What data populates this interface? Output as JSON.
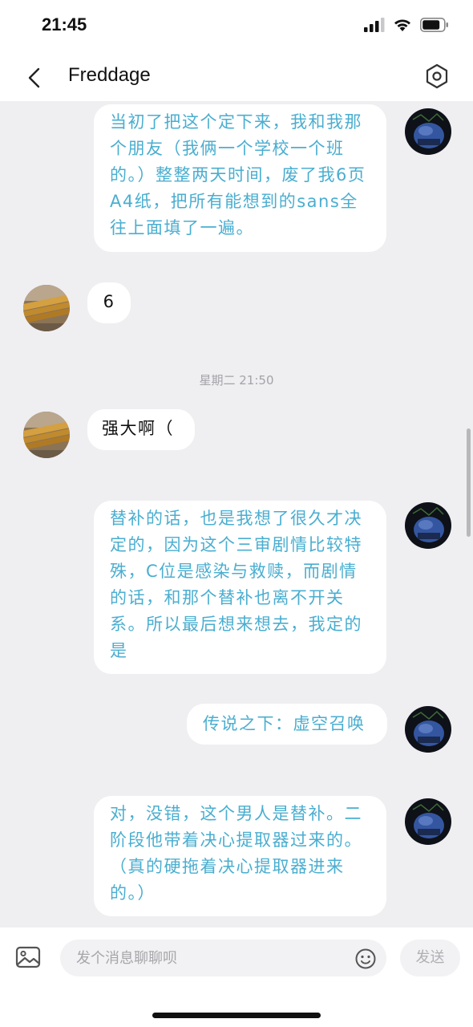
{
  "status_bar": {
    "time": "21:45"
  },
  "header": {
    "title": "Freddage"
  },
  "messages": [
    {
      "side": "mine",
      "text": "当初了把这个定下来，我和我那个朋友（我俩一个学校一个班的。）整整两天时间，废了我6页A4纸，把所有能想到的sans全往上面填了一遍。"
    },
    {
      "side": "theirs",
      "text": "6"
    },
    {
      "side": "theirs",
      "text": "强大啊（"
    },
    {
      "side": "mine",
      "text": "替补的话，也是我想了很久才决定的，因为这个三审剧情比较特殊，C位是感染与救赎，而剧情的话，和那个替补也离不开关系。所以最后想来想去，我定的是"
    },
    {
      "side": "mine",
      "text": "传说之下：虚空召唤"
    },
    {
      "side": "mine",
      "text": "对，没错，这个男人是替补。二阶段他带着决心提取器过来的。（真的硬拖着决心提取器进来的。）"
    }
  ],
  "timestamp": "星期二 21:50",
  "input_bar": {
    "placeholder": "发个消息聊聊呗",
    "send_label": "发送"
  },
  "colors": {
    "mine_text": "#4aaed0",
    "background": "#efeff2"
  },
  "icons": [
    "back-arrow-icon",
    "settings-hexagon-icon",
    "image-icon",
    "emoji-icon",
    "signal-icon",
    "wifi-icon",
    "battery-icon"
  ]
}
